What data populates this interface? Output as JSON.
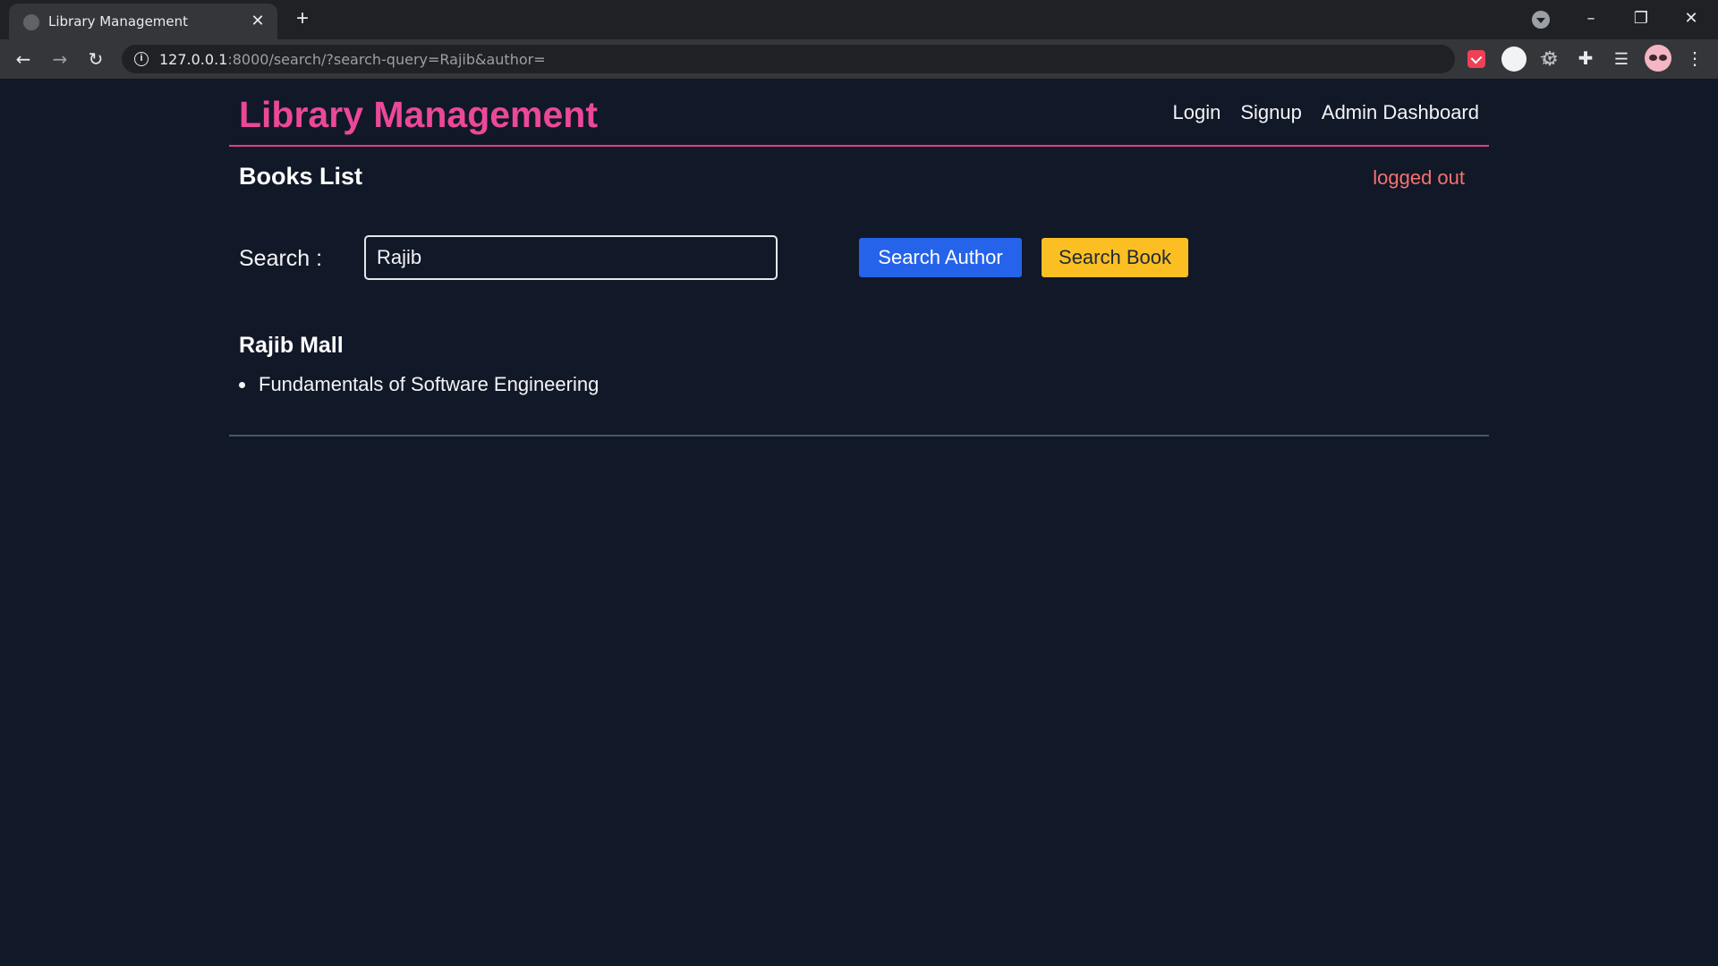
{
  "browser": {
    "tab_title": "Library Management",
    "url_host": "127.0.0.1",
    "url_rest": ":8000/search/?search-query=Rajib&author="
  },
  "header": {
    "brand": "Library Management",
    "nav": [
      "Login",
      "Signup",
      "Admin Dashboard"
    ]
  },
  "page": {
    "title": "Books List",
    "status": "logged out"
  },
  "search": {
    "label": "Search :",
    "value": "Rajib",
    "author_button": "Search Author",
    "book_button": "Search Book"
  },
  "results": {
    "author": "Rajib Mall",
    "books": [
      "Fundamentals of Software Engineering"
    ]
  },
  "colors": {
    "background": "#111827",
    "brand": "#ec4899",
    "status": "#f87171",
    "author_button": "#2563eb",
    "book_button": "#fbbf24"
  },
  "icons": {
    "tab": "globe-icon",
    "new_tab": "plus-icon",
    "back": "arrow-left-icon",
    "forward": "arrow-right-icon",
    "reload": "reload-icon",
    "site_info": "info-icon",
    "zoom": "zoom-icon",
    "bookmark": "star-icon",
    "extensions": "puzzle-icon",
    "menu": "kebab-menu-icon"
  }
}
